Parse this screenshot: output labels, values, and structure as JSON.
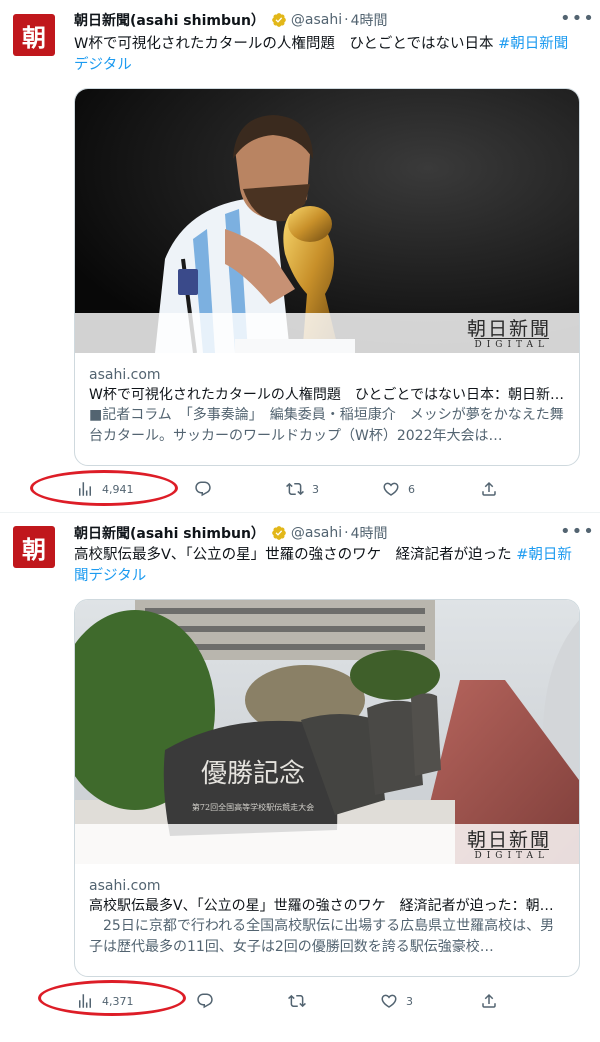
{
  "colors": {
    "accent": "#1d9bf0",
    "avatar": "#c0171c",
    "annotation": "#dd1d27",
    "verified": "#e2b719"
  },
  "tweets": [
    {
      "avatar_char": "朝",
      "author": "朝日新聞(asahi shimbun）",
      "handle": "@asahi",
      "separator": "·",
      "time": "4時間",
      "more_icon": "more-horizontal-icon",
      "text": "W杯で可視化されたカタールの人権問題　ひとごとではない日本 ",
      "hashtag": "#朝日新聞デジタル",
      "card": {
        "watermark": "朝日新聞",
        "watermark_sub": "DIGITAL",
        "domain": "asahi.com",
        "title": "W杯で可視化されたカタールの人権問題　ひとごとではない日本：朝日新聞デジタル",
        "description": "■記者コラム　「多事奏論」　編集委員・稲垣康介　メッシが夢をかなえた舞台カタール。サッカーのワールドカップ（W杯）2022年大会は…"
      },
      "views": "4,941",
      "replies": "",
      "retweets": "3",
      "likes": "6"
    },
    {
      "avatar_char": "朝",
      "author": "朝日新聞(asahi shimbun）",
      "handle": "@asahi",
      "separator": "·",
      "time": "4時間",
      "more_icon": "more-horizontal-icon",
      "text": "高校駅伝最多V、「公立の星」世羅の強さのワケ　経済記者が迫った ",
      "hashtag": "#朝日新聞デジタル",
      "card": {
        "watermark": "朝日新聞",
        "watermark_sub": "DIGITAL",
        "domain": "asahi.com",
        "title": "高校駅伝最多V、「公立の星」世羅の強さのワケ　経済記者が迫った：朝日新聞デジタル",
        "description": "　25日に京都で行われる全国高校駅伝に出場する広島県立世羅高校は、男子は歴代最多の11回、女子は2回の優勝回数を誇る駅伝強豪校…",
        "stone_text": "優勝記念",
        "stone_text_small": "第72回全国高等学校駅伝競走大会"
      },
      "views": "4,371",
      "replies": "",
      "retweets": "",
      "likes": "3"
    }
  ]
}
